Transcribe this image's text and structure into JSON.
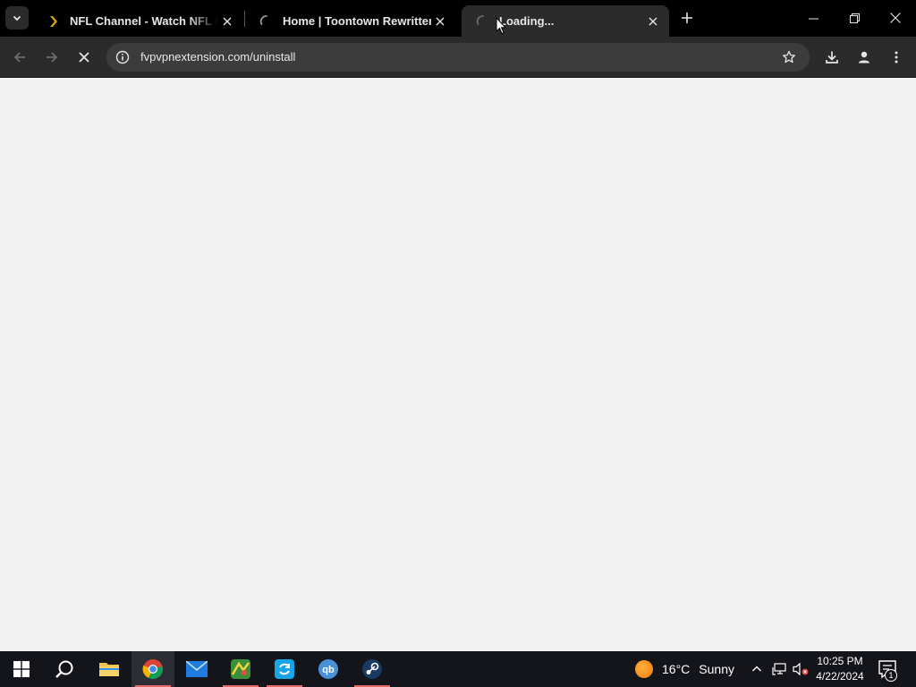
{
  "browser": {
    "tabs": [
      {
        "title": "NFL Channel - Watch NFL Channel",
        "favicon": "plex-chevron-icon",
        "state": "loaded"
      },
      {
        "title": "Home | Toontown Rewritten",
        "favicon": "loading-spinner-icon",
        "state": "loading"
      },
      {
        "title": "Loading...",
        "favicon": "loading-spinner-icon",
        "state": "loading",
        "active": true
      }
    ],
    "address_bar": {
      "url": "fvpvpnextension.com/uninstall"
    }
  },
  "taskbar": {
    "apps": [
      "start",
      "search",
      "file-explorer",
      "chrome",
      "mail",
      "maps-app",
      "sync-app",
      "qbittorrent",
      "steam"
    ],
    "weather": {
      "temperature": "16°C",
      "condition": "Sunny"
    },
    "clock": {
      "time": "10:25 PM",
      "date": "4/22/2024"
    },
    "notification_count": "1"
  },
  "colors": {
    "accent_plex": "#e5a00d",
    "taskbar_active_underline": "#e46a6a",
    "page_background": "#f2f2f2"
  }
}
